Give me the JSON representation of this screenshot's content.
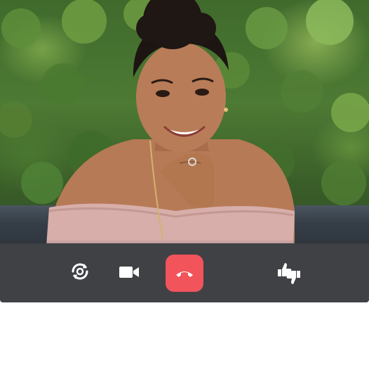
{
  "call": {
    "controls": [
      {
        "name": "switch-camera-button",
        "icon": "camera-switch-icon"
      },
      {
        "name": "video-toggle-button",
        "icon": "video-camera-icon"
      },
      {
        "name": "end-call-button",
        "icon": "phone-hangup-icon",
        "color": "#f2545b"
      },
      {
        "name": "feedback-button",
        "icon": "thumbs-up-down-icon"
      }
    ]
  },
  "colors": {
    "callbar_bg": "#3f4145",
    "end_call": "#f2545b",
    "icon": "#ffffff"
  }
}
